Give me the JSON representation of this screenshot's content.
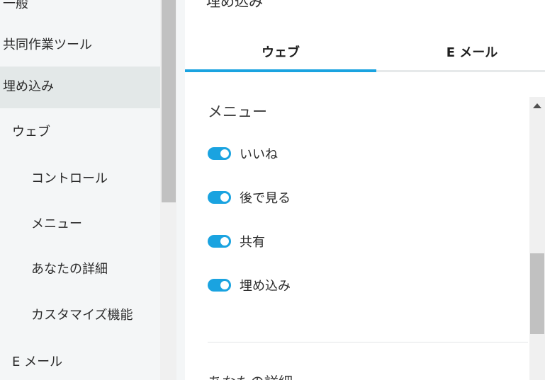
{
  "sidebar": {
    "items": [
      {
        "label": "一般"
      },
      {
        "label": "共同作業ツール"
      },
      {
        "label": "埋め込み"
      },
      {
        "label": "ウェブ"
      },
      {
        "label": "コントロール"
      },
      {
        "label": "メニュー"
      },
      {
        "label": "あなたの詳細"
      },
      {
        "label": "カスタマイズ機能"
      },
      {
        "label": "E メール"
      }
    ]
  },
  "main": {
    "section_heading_top": "埋め込み",
    "tabs": [
      {
        "label": "ウェブ",
        "selected": true
      },
      {
        "label": "E メール",
        "selected": false
      }
    ],
    "menu_section": {
      "title": "メニュー",
      "toggles": [
        {
          "label": "いいね",
          "on": true
        },
        {
          "label": "後で見る",
          "on": true
        },
        {
          "label": "共有",
          "on": true
        },
        {
          "label": "埋め込み",
          "on": true
        }
      ]
    },
    "next_section_title": "あなたの詳細"
  },
  "colors": {
    "accent": "#1aa3e0",
    "sidebar_bg": "#f4f6f7",
    "sidebar_active_bg": "#e3e8e8"
  }
}
